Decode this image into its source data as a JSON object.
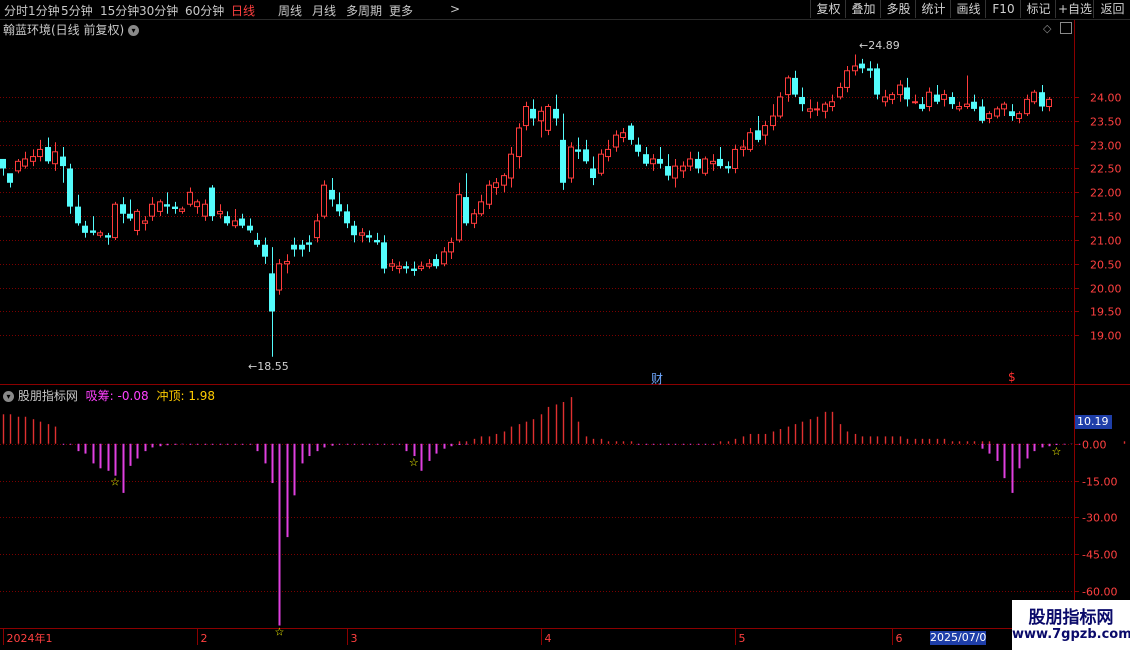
{
  "toolbar": {
    "periods": [
      "分时",
      "1分钟",
      "5分钟",
      "15分钟",
      "30分钟",
      "60分钟",
      "日线",
      "周线",
      "月线",
      "多周期",
      "更多"
    ],
    "active_period": "日线",
    "more_arrow": ">",
    "buttons": [
      "复权",
      "叠加",
      "多股",
      "统计",
      "画线",
      "F10",
      "标记",
      "+自选",
      "返回"
    ]
  },
  "main_panel": {
    "title": "翰蓝环境(日线 前复权)",
    "max_label": "24.89",
    "min_label": "18.55",
    "fin_marker": "财",
    "s_marker": "$"
  },
  "indicator_panel": {
    "name": "股朋指标网",
    "items": [
      {
        "label": "吸筹:",
        "value": "-0.08",
        "color": "#ff40ff"
      },
      {
        "label": "冲顶:",
        "value": "1.98",
        "color": "#ffcc00"
      }
    ],
    "current_value": "10.19"
  },
  "x_axis": {
    "labels": [
      "2024年1",
      "2",
      "3",
      "4",
      "5",
      "6"
    ],
    "cursor_date": "2025/07/0"
  },
  "watermark": {
    "line1": "股朋指标网",
    "line2": "www.7gpzb.com"
  },
  "colors": {
    "up": "#ff3c3c",
    "down": "#54fcfc",
    "absorb": "#e040e0",
    "peak": "#e03030",
    "star": "#ffff00",
    "grid": "#7a0000"
  },
  "chart_data": [
    {
      "type": "candlestick",
      "title": "翰蓝环境(日线 前复权)",
      "y_ticks": [
        19.0,
        19.5,
        20.0,
        20.5,
        21.0,
        21.5,
        22.0,
        22.5,
        23.0,
        23.5,
        24.0
      ],
      "ylim": [
        18.0,
        25.3
      ],
      "max": 24.89,
      "min": 18.55,
      "months": [
        "2024年1",
        "2",
        "3",
        "4",
        "5",
        "6"
      ],
      "ohlc": [
        [
          22.7,
          22.65,
          22.35,
          22.5
        ],
        [
          22.4,
          22.35,
          22.1,
          22.2
        ],
        [
          22.45,
          22.7,
          22.4,
          22.65
        ],
        [
          22.55,
          22.85,
          22.5,
          22.7
        ],
        [
          22.65,
          22.9,
          22.55,
          22.75
        ],
        [
          22.75,
          23.1,
          22.65,
          22.9
        ],
        [
          22.95,
          23.15,
          22.6,
          22.65
        ],
        [
          22.6,
          23.05,
          22.45,
          22.85
        ],
        [
          22.75,
          22.95,
          22.2,
          22.55
        ],
        [
          22.5,
          22.6,
          21.55,
          21.7
        ],
        [
          21.7,
          21.95,
          21.3,
          21.35
        ],
        [
          21.3,
          21.4,
          21.05,
          21.15
        ],
        [
          21.2,
          21.5,
          21.1,
          21.15
        ],
        [
          21.1,
          21.2,
          21.05,
          21.15
        ],
        [
          21.1,
          21.15,
          20.9,
          21.05
        ],
        [
          21.05,
          21.8,
          21.0,
          21.75
        ],
        [
          21.75,
          21.9,
          21.35,
          21.55
        ],
        [
          21.55,
          21.85,
          21.4,
          21.45
        ],
        [
          21.2,
          21.65,
          21.1,
          21.6
        ],
        [
          21.35,
          21.5,
          21.2,
          21.4
        ],
        [
          21.5,
          21.9,
          21.4,
          21.75
        ],
        [
          21.6,
          21.85,
          21.5,
          21.8
        ],
        [
          21.75,
          22.0,
          21.55,
          21.7
        ],
        [
          21.7,
          21.8,
          21.55,
          21.65
        ],
        [
          21.6,
          21.7,
          21.55,
          21.65
        ],
        [
          21.75,
          22.1,
          21.7,
          22.0
        ],
        [
          21.7,
          21.85,
          21.55,
          21.8
        ],
        [
          21.5,
          21.85,
          21.4,
          21.75
        ],
        [
          22.1,
          22.15,
          21.4,
          21.5
        ],
        [
          21.55,
          21.75,
          21.45,
          21.6
        ],
        [
          21.5,
          21.6,
          21.3,
          21.35
        ],
        [
          21.3,
          21.65,
          21.25,
          21.4
        ],
        [
          21.45,
          21.55,
          21.25,
          21.3
        ],
        [
          21.3,
          21.45,
          21.15,
          21.2
        ],
        [
          21.0,
          21.15,
          20.85,
          20.9
        ],
        [
          20.9,
          21.05,
          20.5,
          20.65
        ],
        [
          20.3,
          20.85,
          18.55,
          19.5
        ],
        [
          19.95,
          20.6,
          19.85,
          20.5
        ],
        [
          20.5,
          20.7,
          20.3,
          20.55
        ],
        [
          20.9,
          21.05,
          20.65,
          20.8
        ],
        [
          20.9,
          21.0,
          20.65,
          20.8
        ],
        [
          20.95,
          21.1,
          20.75,
          20.9
        ],
        [
          21.05,
          21.55,
          20.95,
          21.4
        ],
        [
          21.5,
          22.25,
          21.45,
          22.15
        ],
        [
          22.05,
          22.3,
          21.7,
          21.85
        ],
        [
          21.75,
          22.0,
          21.5,
          21.6
        ],
        [
          21.6,
          21.75,
          21.25,
          21.35
        ],
        [
          21.3,
          21.4,
          20.95,
          21.1
        ],
        [
          21.1,
          21.25,
          20.95,
          21.15
        ],
        [
          21.1,
          21.2,
          20.95,
          21.05
        ],
        [
          21.0,
          21.15,
          20.9,
          20.95
        ],
        [
          20.95,
          21.1,
          20.3,
          20.4
        ],
        [
          20.45,
          20.6,
          20.35,
          20.5
        ],
        [
          20.4,
          20.55,
          20.3,
          20.45
        ],
        [
          20.45,
          20.55,
          20.3,
          20.4
        ],
        [
          20.4,
          20.55,
          20.25,
          20.35
        ],
        [
          20.4,
          20.55,
          20.35,
          20.45
        ],
        [
          20.45,
          20.6,
          20.4,
          20.5
        ],
        [
          20.6,
          20.7,
          20.4,
          20.45
        ],
        [
          20.5,
          20.85,
          20.45,
          20.75
        ],
        [
          20.75,
          21.05,
          20.6,
          20.95
        ],
        [
          21.0,
          22.2,
          20.95,
          21.95
        ],
        [
          21.9,
          22.4,
          21.3,
          21.35
        ],
        [
          21.35,
          21.65,
          21.25,
          21.55
        ],
        [
          21.55,
          21.95,
          21.5,
          21.8
        ],
        [
          21.75,
          22.25,
          21.65,
          22.15
        ],
        [
          22.1,
          22.3,
          21.95,
          22.2
        ],
        [
          22.15,
          22.4,
          22.0,
          22.35
        ],
        [
          22.3,
          22.95,
          22.1,
          22.8
        ],
        [
          22.75,
          23.45,
          22.5,
          23.35
        ],
        [
          23.4,
          23.9,
          23.3,
          23.8
        ],
        [
          23.75,
          23.95,
          23.4,
          23.55
        ],
        [
          23.5,
          23.8,
          23.15,
          23.7
        ],
        [
          23.3,
          23.85,
          23.2,
          23.8
        ],
        [
          23.75,
          24.05,
          23.4,
          23.55
        ],
        [
          23.1,
          23.65,
          22.05,
          22.2
        ],
        [
          22.3,
          23.05,
          22.2,
          22.95
        ],
        [
          22.9,
          23.15,
          22.7,
          22.85
        ],
        [
          22.9,
          23.1,
          22.6,
          22.65
        ],
        [
          22.5,
          22.75,
          22.15,
          22.3
        ],
        [
          22.4,
          22.9,
          22.35,
          22.8
        ],
        [
          22.75,
          23.1,
          22.65,
          22.9
        ],
        [
          22.95,
          23.3,
          22.85,
          23.2
        ],
        [
          23.15,
          23.35,
          23.05,
          23.25
        ],
        [
          23.4,
          23.45,
          23.0,
          23.1
        ],
        [
          23.0,
          23.15,
          22.75,
          22.85
        ],
        [
          22.8,
          22.95,
          22.55,
          22.6
        ],
        [
          22.6,
          22.8,
          22.45,
          22.7
        ],
        [
          22.7,
          22.95,
          22.5,
          22.6
        ],
        [
          22.55,
          22.8,
          22.25,
          22.35
        ],
        [
          22.3,
          22.7,
          22.1,
          22.55
        ],
        [
          22.45,
          22.65,
          22.3,
          22.55
        ],
        [
          22.55,
          22.85,
          22.45,
          22.7
        ],
        [
          22.7,
          22.85,
          22.4,
          22.5
        ],
        [
          22.4,
          22.75,
          22.35,
          22.7
        ],
        [
          22.6,
          22.8,
          22.45,
          22.65
        ],
        [
          22.7,
          22.95,
          22.5,
          22.55
        ],
        [
          22.55,
          22.65,
          22.4,
          22.5
        ],
        [
          22.5,
          23.0,
          22.4,
          22.9
        ],
        [
          22.9,
          23.1,
          22.75,
          22.95
        ],
        [
          22.9,
          23.35,
          22.85,
          23.25
        ],
        [
          23.3,
          23.6,
          23.05,
          23.1
        ],
        [
          23.2,
          23.5,
          23.0,
          23.4
        ],
        [
          23.4,
          23.85,
          23.3,
          23.6
        ],
        [
          23.6,
          24.1,
          23.55,
          24.0
        ],
        [
          24.05,
          24.45,
          23.9,
          24.4
        ],
        [
          24.4,
          24.55,
          24.0,
          24.05
        ],
        [
          24.0,
          24.2,
          23.7,
          23.85
        ],
        [
          23.7,
          23.95,
          23.55,
          23.75
        ],
        [
          23.75,
          23.9,
          23.6,
          23.75
        ],
        [
          23.7,
          23.9,
          23.55,
          23.85
        ],
        [
          23.8,
          24.05,
          23.7,
          23.9
        ],
        [
          24.0,
          24.3,
          23.95,
          24.2
        ],
        [
          24.2,
          24.65,
          24.1,
          24.55
        ],
        [
          24.55,
          24.89,
          24.45,
          24.65
        ],
        [
          24.7,
          24.8,
          24.5,
          24.6
        ],
        [
          24.6,
          24.75,
          24.4,
          24.55
        ],
        [
          24.6,
          24.7,
          23.95,
          24.05
        ],
        [
          23.9,
          24.15,
          23.8,
          24.0
        ],
        [
          23.95,
          24.1,
          23.85,
          24.05
        ],
        [
          24.05,
          24.35,
          23.9,
          24.25
        ],
        [
          24.2,
          24.4,
          23.8,
          23.95
        ],
        [
          23.9,
          24.05,
          23.85,
          23.9
        ],
        [
          23.85,
          24.0,
          23.7,
          23.75
        ],
        [
          23.8,
          24.2,
          23.7,
          24.1
        ],
        [
          24.05,
          24.25,
          23.85,
          23.9
        ],
        [
          23.95,
          24.15,
          23.8,
          24.05
        ],
        [
          24.0,
          24.1,
          23.75,
          23.85
        ],
        [
          23.75,
          23.9,
          23.7,
          23.8
        ],
        [
          23.8,
          24.45,
          23.75,
          23.85
        ],
        [
          23.9,
          24.05,
          23.7,
          23.75
        ],
        [
          23.8,
          23.95,
          23.45,
          23.5
        ],
        [
          23.55,
          23.7,
          23.45,
          23.65
        ],
        [
          23.6,
          23.8,
          23.55,
          23.75
        ],
        [
          23.75,
          23.9,
          23.6,
          23.85
        ],
        [
          23.7,
          23.85,
          23.5,
          23.6
        ],
        [
          23.55,
          23.7,
          23.45,
          23.65
        ],
        [
          23.65,
          24.05,
          23.6,
          23.95
        ],
        [
          23.9,
          24.15,
          23.85,
          24.1
        ],
        [
          24.1,
          24.25,
          23.7,
          23.8
        ],
        [
          23.8,
          24.0,
          23.7,
          23.95
        ]
      ]
    },
    {
      "type": "bar",
      "title": "股朋指标网",
      "y_ticks": [
        10.19,
        0.0,
        -15.0,
        -30.0,
        -45.0,
        -60.0
      ],
      "ylim": [
        -75,
        17
      ],
      "series": [
        {
          "name": "吸筹",
          "values": [
            0,
            0,
            0,
            0,
            0,
            0,
            0,
            0,
            0,
            0,
            -3,
            -4,
            -8,
            -10,
            -11,
            -13,
            -20,
            -9,
            -6,
            -3,
            -1.5,
            -1,
            -0.6,
            -0.4,
            -0.2,
            0,
            0,
            0,
            0,
            0,
            0,
            0,
            0,
            0,
            -3,
            -8,
            -16,
            -74,
            -38,
            -21,
            -8,
            -5,
            -3,
            -1.5,
            -0.8,
            0,
            0,
            0,
            0,
            0,
            0,
            0,
            0,
            0,
            -3,
            -5,
            -11,
            -7,
            -4,
            -2,
            -1,
            -0.5,
            -0.3,
            0,
            0,
            0,
            0,
            0,
            0,
            0,
            0,
            0,
            0,
            0,
            0,
            0,
            0,
            0,
            0,
            0,
            0,
            0,
            0,
            0,
            0,
            0,
            0,
            0,
            0,
            0,
            0,
            0,
            0,
            0,
            0,
            0,
            0,
            0,
            0,
            0,
            0,
            0,
            0,
            0,
            0,
            0,
            0,
            0,
            0,
            0,
            0,
            0,
            0,
            0,
            0,
            0,
            0,
            0,
            0,
            0,
            0,
            0,
            0,
            0,
            0,
            0,
            0,
            0,
            0,
            0,
            0,
            -2,
            -4,
            -7,
            -14,
            -20,
            -10,
            -6,
            -3,
            -1.5,
            -1,
            -0.5,
            -0.3,
            -0.1,
            0
          ]
        },
        {
          "name": "冲顶",
          "values": [
            12,
            12,
            11,
            11,
            10,
            9,
            8,
            7,
            0,
            0,
            0,
            0,
            0,
            0,
            0,
            0,
            0,
            0,
            0,
            0,
            0,
            0,
            0,
            0,
            0,
            0,
            0,
            0,
            0,
            0,
            0,
            0,
            0,
            0,
            0,
            0,
            0,
            0,
            0,
            0,
            0,
            0,
            0,
            0,
            0,
            0,
            0,
            0,
            0,
            0,
            0,
            0,
            0,
            0,
            0,
            0,
            0,
            0,
            0,
            0,
            0,
            1,
            1,
            2,
            3,
            3,
            4,
            5,
            7,
            8,
            9,
            10,
            12,
            15,
            16,
            17,
            19,
            9,
            3,
            2,
            2,
            1,
            1,
            1,
            1,
            0,
            0,
            0,
            0,
            0,
            0,
            0,
            0,
            0,
            0,
            0,
            1,
            1,
            2,
            3,
            4,
            4,
            4,
            5,
            6,
            7,
            8,
            9,
            10,
            11,
            13,
            13,
            8,
            5,
            4,
            3,
            3,
            3,
            3,
            3,
            3,
            2,
            2,
            2,
            2,
            2,
            2,
            1,
            1,
            1,
            1,
            1,
            1,
            0,
            0,
            0,
            0,
            0,
            0,
            0,
            0,
            0,
            0,
            0,
            0,
            0,
            0,
            0,
            0,
            0,
            1,
            1,
            1,
            2,
            2,
            2
          ]
        }
      ],
      "stars": [
        15,
        37,
        55,
        141
      ]
    }
  ]
}
